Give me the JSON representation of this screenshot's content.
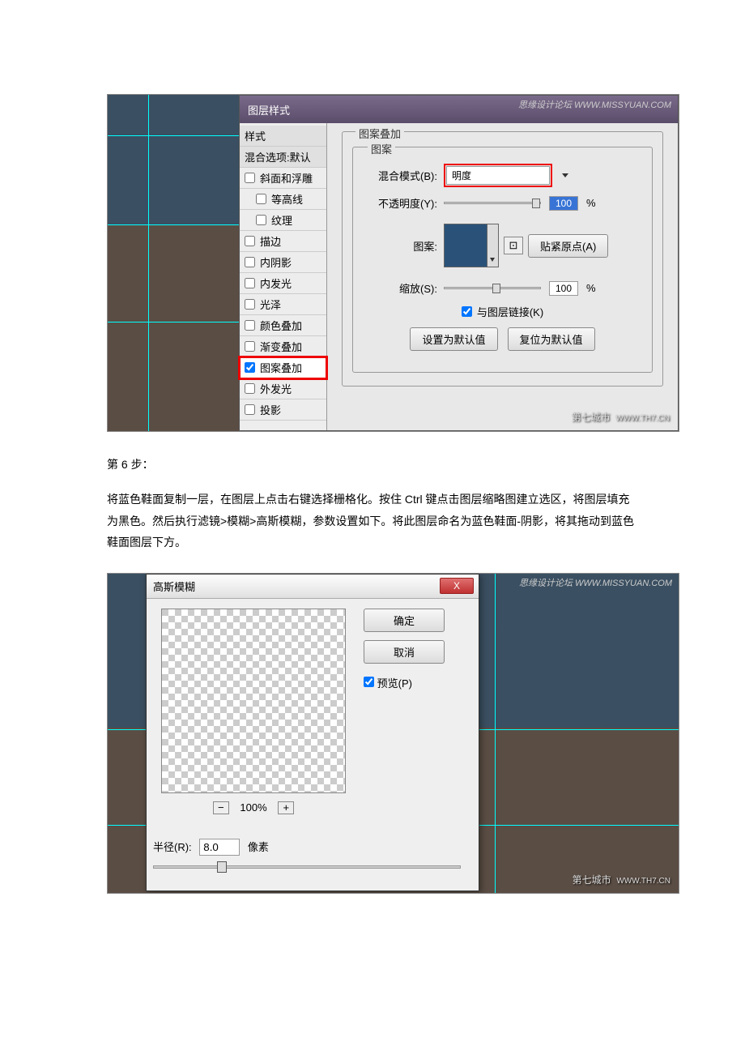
{
  "dialog1": {
    "title": "图层样式",
    "watermark": "思缘设计论坛 WWW.MISSYUAN.COM",
    "styles": {
      "header1": "样式",
      "header2": "混合选项:默认",
      "items": [
        {
          "label": "斜面和浮雕",
          "checked": false,
          "indent": false
        },
        {
          "label": "等高线",
          "checked": false,
          "indent": true
        },
        {
          "label": "纹理",
          "checked": false,
          "indent": true
        },
        {
          "label": "描边",
          "checked": false,
          "indent": false
        },
        {
          "label": "内阴影",
          "checked": false,
          "indent": false
        },
        {
          "label": "内发光",
          "checked": false,
          "indent": false
        },
        {
          "label": "光泽",
          "checked": false,
          "indent": false
        },
        {
          "label": "颜色叠加",
          "checked": false,
          "indent": false
        },
        {
          "label": "渐变叠加",
          "checked": false,
          "indent": false
        },
        {
          "label": "图案叠加",
          "checked": true,
          "indent": false,
          "highlighted": true
        },
        {
          "label": "外发光",
          "checked": false,
          "indent": false
        },
        {
          "label": "投影",
          "checked": false,
          "indent": false
        }
      ]
    },
    "panel": {
      "title": "图案叠加",
      "subtitle": "图案",
      "blend_mode_label": "混合模式(B):",
      "blend_mode_value": "明度",
      "opacity_label": "不透明度(Y):",
      "opacity_value": "100",
      "percent": "%",
      "pattern_label": "图案:",
      "snap_button": "贴紧原点(A)",
      "scale_label": "缩放(S):",
      "scale_value": "100",
      "link_label": "与图层链接(K)",
      "link_checked": true,
      "default_btn": "设置为默认值",
      "reset_btn": "复位为默认值"
    },
    "bottom_watermark": "第七城市",
    "bottom_url": "WWW.TH7.CN"
  },
  "article": {
    "step": "第 6 步：",
    "para": "将蓝色鞋面复制一层，在图层上点击右键选择栅格化。按住 Ctrl 键点击图层缩略图建立选区，将图层填充为黑色。然后执行滤镜>模糊>高斯模糊，参数设置如下。将此图层命名为蓝色鞋面-阴影，将其拖动到蓝色鞋面图层下方。"
  },
  "gb": {
    "title": "高斯模糊",
    "close": "X",
    "ok": "确定",
    "cancel": "取消",
    "preview_label": "预览(P)",
    "preview_checked": true,
    "zoom": "100%",
    "minus": "−",
    "plus": "+",
    "radius_label": "半径(R):",
    "radius_value": "8.0",
    "radius_unit": "像素",
    "watermark_tr": "思缘设计论坛 WWW.MISSYUAN.COM",
    "watermark_br": "第七城市",
    "watermark_url": "WWW.TH7.CN"
  }
}
